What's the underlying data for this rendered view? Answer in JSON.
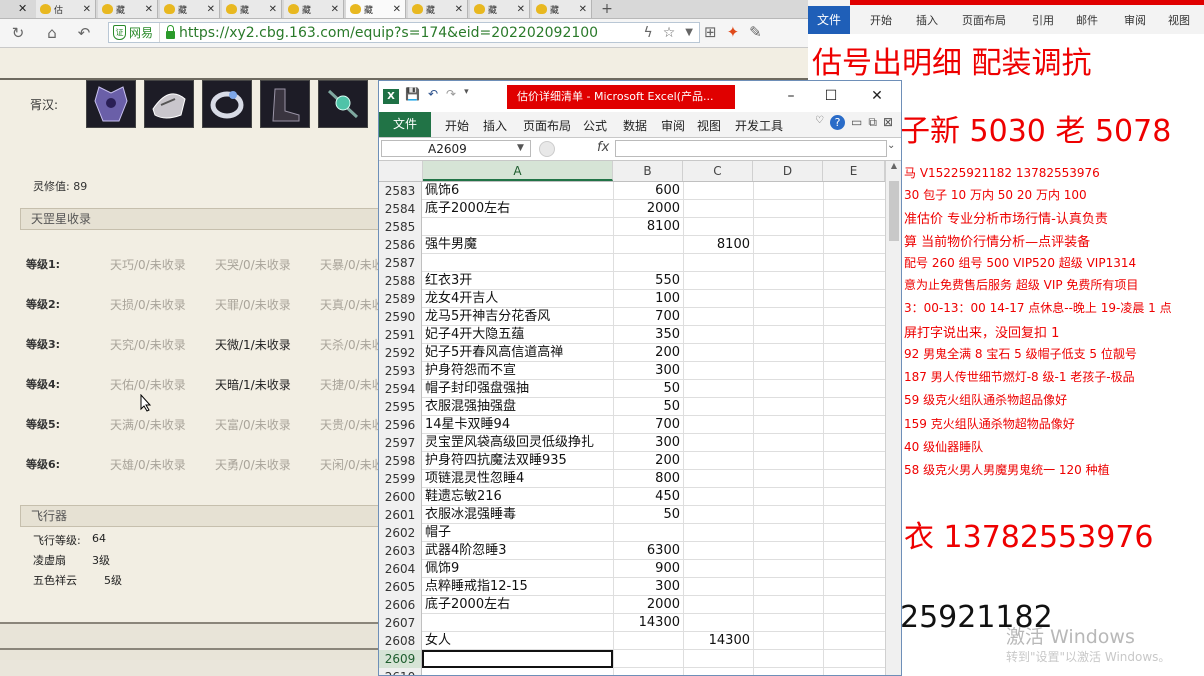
{
  "browser": {
    "tabs": [
      {
        "label": "估",
        "active": false
      },
      {
        "label": "藏",
        "active": false
      },
      {
        "label": "藏",
        "active": false
      },
      {
        "label": "藏",
        "active": false
      },
      {
        "label": "藏",
        "active": false
      },
      {
        "label": "藏",
        "active": true
      },
      {
        "label": "藏",
        "active": false
      },
      {
        "label": "藏",
        "active": false
      },
      {
        "label": "藏",
        "active": false
      }
    ],
    "cert_label": "网易",
    "url": "https://xy2.cbg.163.com/equip?s=174&eid=202202092100213"
  },
  "page": {
    "equip_label": "胥汉:",
    "lingxiu": "灵修值: 89",
    "star_panel_title": "天罡星收录",
    "levels": [
      {
        "label": "等级1:",
        "cells": [
          "天巧/0/未收录",
          "天哭/0/未收录",
          "天暴/0/未收录"
        ]
      },
      {
        "label": "等级2:",
        "cells": [
          "天损/0/未收录",
          "天罪/0/未收录",
          "天真/0/未收录"
        ]
      },
      {
        "label": "等级3:",
        "cells": [
          "天究/0/未收录",
          "天微/1/未收录",
          "天杀/0/未收录"
        ]
      },
      {
        "label": "等级4:",
        "cells": [
          "天佑/0/未收录",
          "天暗/1/未收录",
          "天捷/0/未收录"
        ]
      },
      {
        "label": "等级5:",
        "cells": [
          "天满/0/未收录",
          "天富/0/未收录",
          "天贵/0/未收录"
        ]
      },
      {
        "label": "等级6:",
        "cells": [
          "天雄/0/未收录",
          "天勇/0/未收录",
          "天闲/0/未收录"
        ]
      }
    ],
    "active_cells": [
      "2-1",
      "3-1"
    ],
    "fly_title": "飞行器",
    "fly_rows": [
      {
        "label": "飞行等级:",
        "value": "64"
      },
      {
        "label": "凌虚扇",
        "value": "3级"
      },
      {
        "label": "五色祥云",
        "value": "5级"
      }
    ]
  },
  "excel": {
    "title": "估价详细清单 - Microsoft Excel(产品...",
    "file_tab": "文件",
    "tabs": [
      "开始",
      "插入",
      "页面布局",
      "公式",
      "数据",
      "审阅",
      "视图",
      "开发工具"
    ],
    "name_box": "A2609",
    "fx": "fx",
    "columns": [
      "A",
      "B",
      "C",
      "D",
      "E"
    ],
    "selected_row": "2609",
    "rows": [
      {
        "n": "2583",
        "a": "佩饰6",
        "b": "600",
        "c": ""
      },
      {
        "n": "2584",
        "a": "底子2000左右",
        "b": "2000",
        "c": ""
      },
      {
        "n": "2585",
        "a": "",
        "b": "8100",
        "c": ""
      },
      {
        "n": "2586",
        "a": "强牛男魔",
        "b": "",
        "c": "8100"
      },
      {
        "n": "2587",
        "a": "",
        "b": "",
        "c": ""
      },
      {
        "n": "2588",
        "a": "红衣3开",
        "b": "550",
        "c": ""
      },
      {
        "n": "2589",
        "a": "龙女4开吉人",
        "b": "100",
        "c": ""
      },
      {
        "n": "2590",
        "a": "龙马5开神吉分花香风",
        "b": "700",
        "c": ""
      },
      {
        "n": "2591",
        "a": "妃子4开大隐五蕴",
        "b": "350",
        "c": ""
      },
      {
        "n": "2592",
        "a": "妃子5开春风高信道高禅",
        "b": "200",
        "c": ""
      },
      {
        "n": "2593",
        "a": "护身符怨而不宣",
        "b": "300",
        "c": ""
      },
      {
        "n": "2594",
        "a": "帽子封印强盘强抽",
        "b": "50",
        "c": ""
      },
      {
        "n": "2595",
        "a": "衣服混强抽强盘",
        "b": "50",
        "c": ""
      },
      {
        "n": "2596",
        "a": "14星卡双睡94",
        "b": "700",
        "c": ""
      },
      {
        "n": "2597",
        "a": "灵宝罡风袋高级回灵低级挣扎",
        "b": "300",
        "c": ""
      },
      {
        "n": "2598",
        "a": "护身符四抗魔法双睡935",
        "b": "200",
        "c": ""
      },
      {
        "n": "2599",
        "a": "项链混灵性忽睡4",
        "b": "800",
        "c": ""
      },
      {
        "n": "2600",
        "a": "鞋遗忘敏216",
        "b": "450",
        "c": ""
      },
      {
        "n": "2601",
        "a": "衣服冰混强睡毒",
        "b": "50",
        "c": ""
      },
      {
        "n": "2602",
        "a": "帽子",
        "b": "",
        "c": ""
      },
      {
        "n": "2603",
        "a": "武器4阶忽睡3",
        "b": "6300",
        "c": ""
      },
      {
        "n": "2604",
        "a": "佩饰9",
        "b": "900",
        "c": ""
      },
      {
        "n": "2605",
        "a": "点粹睡戒指12-15",
        "b": "300",
        "c": ""
      },
      {
        "n": "2606",
        "a": "底子2000左右",
        "b": "2000",
        "c": ""
      },
      {
        "n": "2607",
        "a": "",
        "b": "14300",
        "c": ""
      },
      {
        "n": "2608",
        "a": "女人",
        "b": "",
        "c": "14300"
      },
      {
        "n": "2609",
        "a": "",
        "b": "",
        "c": ""
      },
      {
        "n": "2610",
        "a": "",
        "b": "",
        "c": ""
      }
    ]
  },
  "word": {
    "file_tab": "文件",
    "tabs": [
      "开始",
      "插入",
      "页面布局",
      "引用",
      "邮件",
      "审阅",
      "视图"
    ],
    "lines": [
      "估号出明细 配装调抗",
      "子新 5030 老 5078",
      "马 V15225921182    13782553976",
      "30 包子   10 万内 50  20 万内 100",
      "准估价   专业分析市场行情-认真负责",
      "算    当前物价行情分析—点评装备",
      "配号 260    组号 500  VIP520    超级 VIP1314",
      "意为止免费售后服务    超级 VIP 免费所有项目",
      "3：00-13：00  14-17 点休息--晚上 19-凌晨 1 点",
      "屏打字说出来，没回复扣 1",
      "92 男鬼全满 8 宝石 5 级帽子低支 5 位靓号",
      "187 男人传世细节燃灯-8 级-1 老孩子-极品",
      "59 级克火组队通杀物超品像好",
      "159 克火组队通杀物超物品像好",
      "40 级仙器睡队",
      "58 级克火男人男魔男鬼统一 120 种植",
      "衣 13782553976",
      "25921182"
    ]
  },
  "watermark": {
    "line1": "激活 Windows",
    "line2": "转到\"设置\"以激活 Windows。"
  },
  "colors": {
    "excel_green": "#217346",
    "word_blue": "#1f5fb8",
    "title_red": "#e00000",
    "doc_red": "#ee0000"
  }
}
